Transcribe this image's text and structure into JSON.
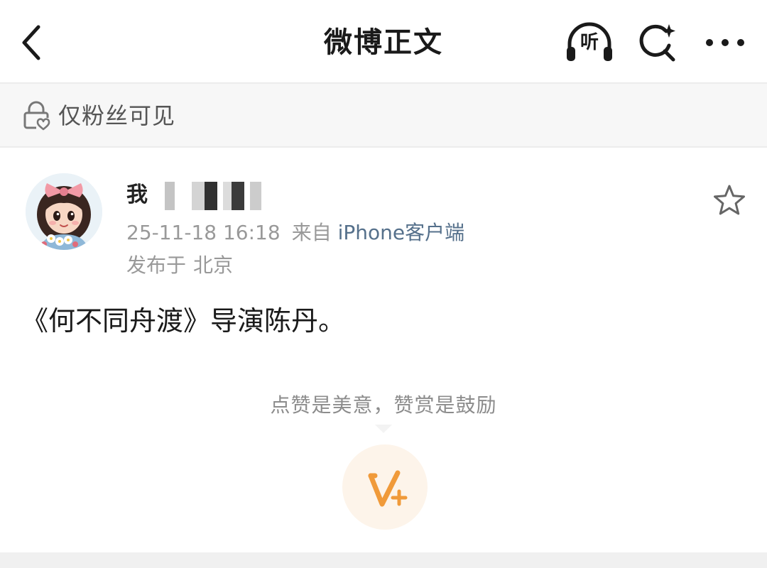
{
  "header": {
    "title": "微博正文",
    "listen_label": "听",
    "icons": {
      "back": "chevron-left-icon",
      "listen": "headphones-icon",
      "search": "search-sparkle-icon",
      "more": "more-dots-icon"
    }
  },
  "visibility": {
    "icon": "lock-heart-icon",
    "text": "仅粉丝可见"
  },
  "post": {
    "username": "我",
    "timestamp": "25-11-18 16:18",
    "source_prefix": "来自",
    "source": "iPhone客户端",
    "location_prefix": "发布于",
    "location": "北京",
    "body": "《何不同舟渡》导演陈丹。",
    "favorite_icon": "star-outline-icon"
  },
  "reward": {
    "hint": "点赞是美意，赞赏是鼓励",
    "icon": "v-plus-reward-icon"
  },
  "colors": {
    "accent_link": "#55708b",
    "reward_orange": "#f09a3a",
    "reward_bg": "#fdf4ea",
    "muted_text": "#999999"
  }
}
